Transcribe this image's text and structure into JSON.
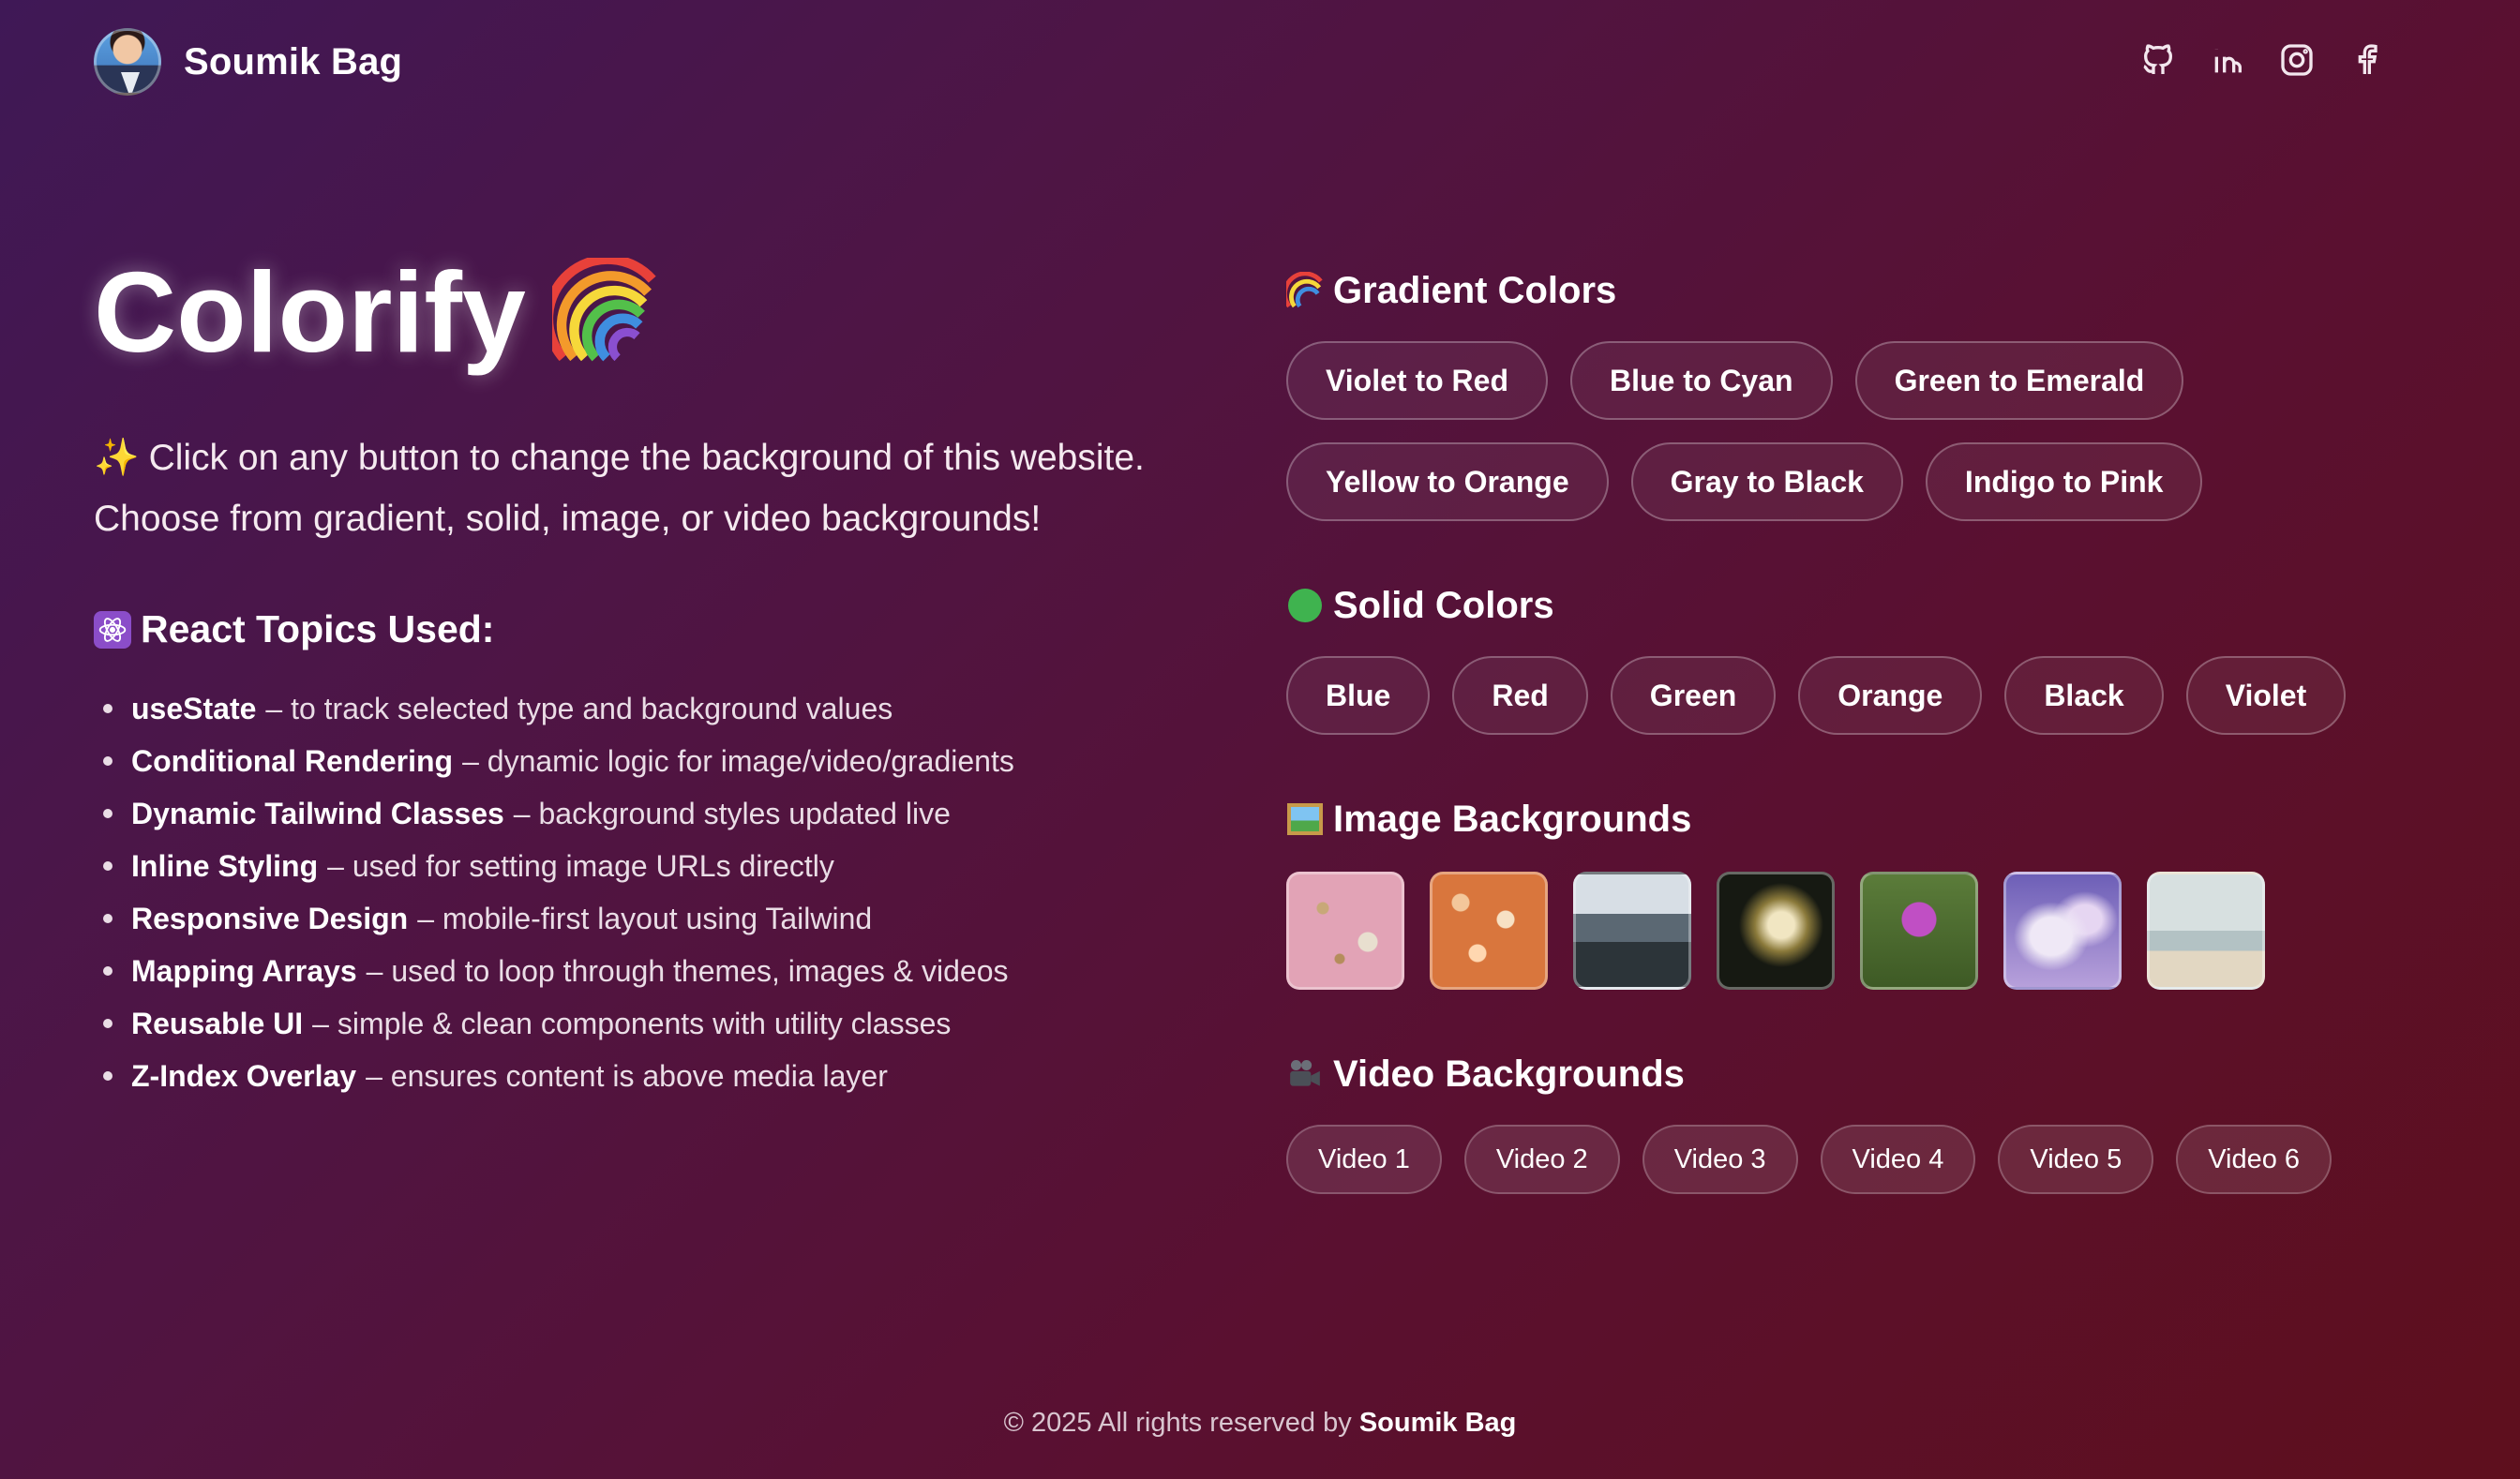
{
  "header": {
    "name": "Soumik Bag",
    "socials": [
      "github-icon",
      "linkedin-icon",
      "instagram-icon",
      "facebook-icon"
    ]
  },
  "hero": {
    "title": "Colorify",
    "intro_line1": "Click on any button to change the background of this website.",
    "intro_line2": "Choose from gradient, solid, image, or video backgrounds!"
  },
  "topics": {
    "title": "React Topics Used:",
    "items": [
      {
        "name": "useState",
        "desc": "– to track selected type and background values"
      },
      {
        "name": "Conditional Rendering",
        "desc": "– dynamic logic for image/video/gradients"
      },
      {
        "name": "Dynamic Tailwind Classes",
        "desc": "– background styles updated live"
      },
      {
        "name": "Inline Styling",
        "desc": "– used for setting image URLs directly"
      },
      {
        "name": "Responsive Design",
        "desc": "– mobile-first layout using Tailwind"
      },
      {
        "name": "Mapping Arrays",
        "desc": "– used to loop through themes, images & videos"
      },
      {
        "name": "Reusable UI",
        "desc": "– simple & clean components with utility classes"
      },
      {
        "name": "Z-Index Overlay",
        "desc": "– ensures content is above media layer"
      }
    ]
  },
  "gradient": {
    "title": "Gradient Colors",
    "buttons": [
      "Violet to Red",
      "Blue to Cyan",
      "Green to Emerald",
      "Yellow to Orange",
      "Gray to Black",
      "Indigo to Pink"
    ]
  },
  "solid": {
    "title": "Solid Colors",
    "buttons": [
      "Blue",
      "Red",
      "Green",
      "Orange",
      "Black",
      "Violet"
    ]
  },
  "images": {
    "title": "Image Backgrounds",
    "count": 7
  },
  "videos": {
    "title": "Video Backgrounds",
    "buttons": [
      "Video 1",
      "Video 2",
      "Video 3",
      "Video 4",
      "Video 5",
      "Video 6"
    ]
  },
  "footer": {
    "text": "© 2025 All rights reserved by",
    "name": "Soumik Bag"
  },
  "colors": {
    "bg_start": "#3f1856",
    "bg_end": "#5e0f1d",
    "solid_dot": "#3fb34f"
  }
}
